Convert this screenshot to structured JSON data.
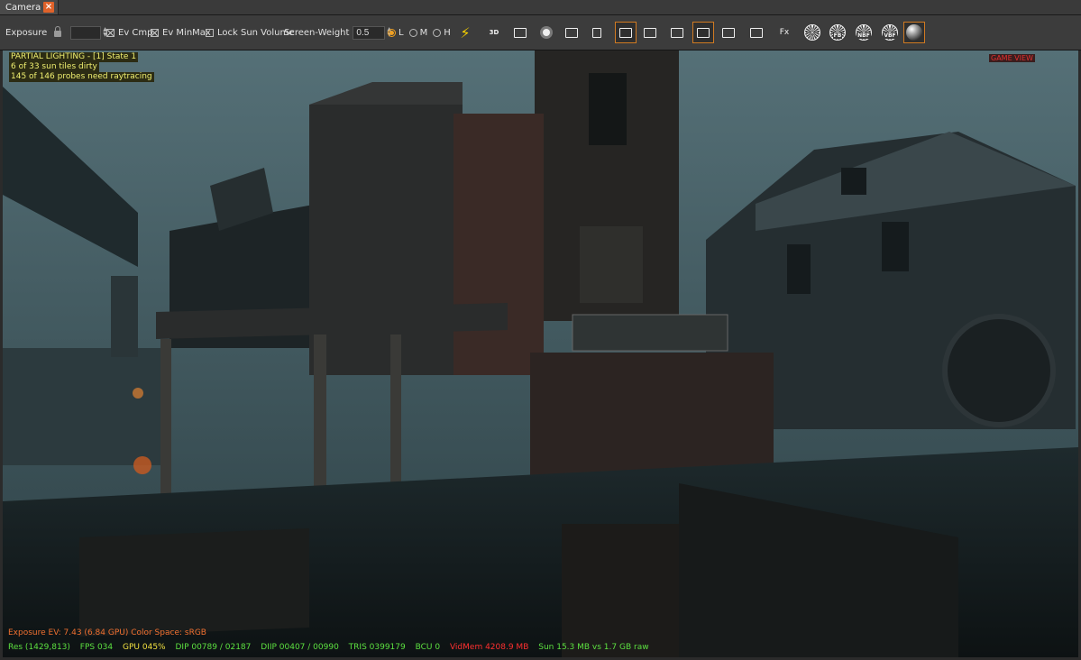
{
  "tab": {
    "label": "Camera",
    "close_glyph": "×"
  },
  "toolbar": {
    "exposure_label": "Exposure",
    "exposure_value": "",
    "ev_cmp_label": "Ev Cmp",
    "ev_minmax_label": "Ev MinMax",
    "lock_sun_label": "Lock Sun Volume",
    "screen_weight_label": "Screen-Weight",
    "screen_weight_value": "0.5",
    "quality_low": "L",
    "quality_med": "M",
    "quality_high": "H",
    "fx_label": "Fx",
    "fb_label": "FB",
    "nbf_label": "NBF",
    "vbf_label": "VBF",
    "btn_3d": "3D",
    "colors": {
      "accent": "#d07a22",
      "bolt": "#f5d000"
    }
  },
  "overlay": {
    "line1": "PARTIAL LIGHTING - [1] State 1",
    "line2": "6 of 33 sun tiles dirty",
    "line3": "145 of 146 probes need raytracing",
    "game_view": "GAME VIEW",
    "exposure": "Exposure EV: 7.43 (6.84 GPU)   Color Space: sRGB",
    "stats": {
      "res": "Res (1429,813)",
      "fps": "FPS 034",
      "gpu": "GPU 045%",
      "dip": "DIP 00789 / 02187",
      "diip": "DIIP 00407 / 00990",
      "tris": "TRIS 0399179",
      "bcu": "BCU 0",
      "vidmem": "VidMem 4208.9 MB",
      "sun": "Sun 15.3 MB vs 1.7 GB raw"
    }
  }
}
